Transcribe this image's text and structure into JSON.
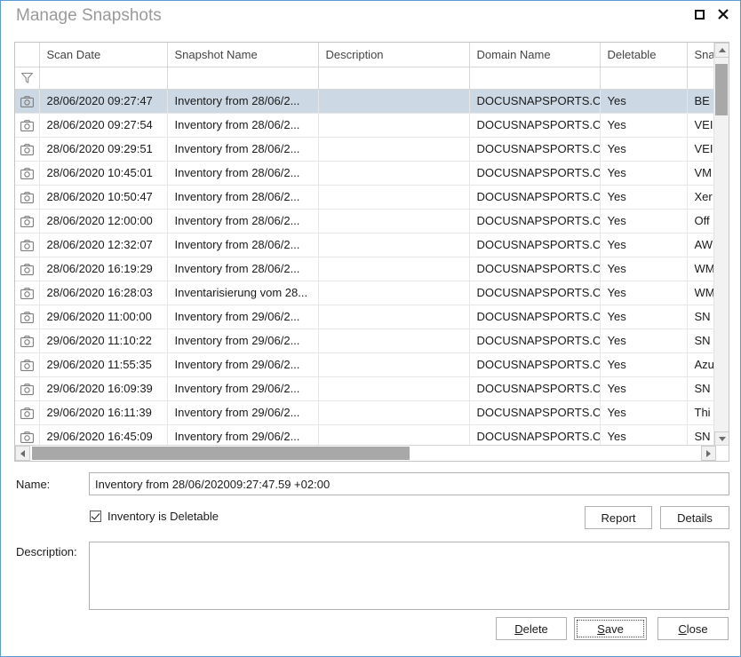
{
  "window": {
    "title": "Manage Snapshots",
    "controls": {
      "maximize": "maximize-icon",
      "close": "close-icon"
    }
  },
  "grid": {
    "columns": [
      {
        "key": "icon",
        "label": ""
      },
      {
        "key": "date",
        "label": "Scan Date"
      },
      {
        "key": "name",
        "label": "Snapshot Name"
      },
      {
        "key": "desc",
        "label": "Description"
      },
      {
        "key": "domain",
        "label": "Domain Name"
      },
      {
        "key": "del",
        "label": "Deletable"
      },
      {
        "key": "snap",
        "label": "Sna"
      }
    ],
    "filter_icon": "funnel-icon",
    "row_icon": "camera-icon",
    "rows": [
      {
        "date": "28/06/2020 09:27:47",
        "name": "Inventory from 28/06/2...",
        "desc": "",
        "domain": "DOCUSNAPSPORTS.C...",
        "del": "Yes",
        "snap": "BE",
        "selected": true
      },
      {
        "date": "28/06/2020 09:27:54",
        "name": "Inventory from 28/06/2...",
        "desc": "",
        "domain": "DOCUSNAPSPORTS.C...",
        "del": "Yes",
        "snap": "VEI",
        "selected": false
      },
      {
        "date": "28/06/2020 09:29:51",
        "name": "Inventory from 28/06/2...",
        "desc": "",
        "domain": "DOCUSNAPSPORTS.C...",
        "del": "Yes",
        "snap": "VEI",
        "selected": false
      },
      {
        "date": "28/06/2020 10:45:01",
        "name": "Inventory from 28/06/2...",
        "desc": "",
        "domain": "DOCUSNAPSPORTS.C...",
        "del": "Yes",
        "snap": "VM",
        "selected": false
      },
      {
        "date": "28/06/2020 10:50:47",
        "name": "Inventory from 28/06/2...",
        "desc": "",
        "domain": "DOCUSNAPSPORTS.C...",
        "del": "Yes",
        "snap": "Xer",
        "selected": false
      },
      {
        "date": "28/06/2020 12:00:00",
        "name": "Inventory from 28/06/2...",
        "desc": "",
        "domain": "DOCUSNAPSPORTS.C...",
        "del": "Yes",
        "snap": "Off",
        "selected": false
      },
      {
        "date": "28/06/2020 12:32:07",
        "name": "Inventory from 28/06/2...",
        "desc": "",
        "domain": "DOCUSNAPSPORTS.C...",
        "del": "Yes",
        "snap": "AW",
        "selected": false
      },
      {
        "date": "28/06/2020 16:19:29",
        "name": "Inventory from 28/06/2...",
        "desc": "",
        "domain": "DOCUSNAPSPORTS.C...",
        "del": "Yes",
        "snap": "WM",
        "selected": false
      },
      {
        "date": "28/06/2020 16:28:03",
        "name": "Inventarisierung vom 28...",
        "desc": "",
        "domain": "DOCUSNAPSPORTS.C...",
        "del": "Yes",
        "snap": "WM",
        "selected": false
      },
      {
        "date": "29/06/2020 11:00:00",
        "name": "Inventory from 29/06/2...",
        "desc": "",
        "domain": "DOCUSNAPSPORTS.C...",
        "del": "Yes",
        "snap": "SN",
        "selected": false
      },
      {
        "date": "29/06/2020 11:10:22",
        "name": "Inventory from 29/06/2...",
        "desc": "",
        "domain": "DOCUSNAPSPORTS.C...",
        "del": "Yes",
        "snap": "SN",
        "selected": false
      },
      {
        "date": "29/06/2020 11:55:35",
        "name": "Inventory from 29/06/2...",
        "desc": "",
        "domain": "DOCUSNAPSPORTS.C...",
        "del": "Yes",
        "snap": "Azu",
        "selected": false
      },
      {
        "date": "29/06/2020 16:09:39",
        "name": "Inventory from 29/06/2...",
        "desc": "",
        "domain": "DOCUSNAPSPORTS.C...",
        "del": "Yes",
        "snap": "SN",
        "selected": false
      },
      {
        "date": "29/06/2020 16:11:39",
        "name": "Inventory from 29/06/2...",
        "desc": "",
        "domain": "DOCUSNAPSPORTS.C...",
        "del": "Yes",
        "snap": "Thi",
        "selected": false
      },
      {
        "date": "29/06/2020 16:45:09",
        "name": "Inventory from 29/06/2...",
        "desc": "",
        "domain": "DOCUSNAPSPORTS.C...",
        "del": "Yes",
        "snap": "SN",
        "selected": false
      }
    ]
  },
  "form": {
    "name_label": "Name:",
    "name_value": "Inventory from 28/06/202009:27:47.59 +02:00",
    "description_label": "Description:",
    "description_value": "",
    "deletable_label": "Inventory is Deletable",
    "deletable_checked": true,
    "report_label": "Report",
    "details_label": "Details"
  },
  "footer": {
    "delete": {
      "pre": "",
      "accel": "D",
      "post": "elete"
    },
    "save": {
      "pre": "",
      "accel": "S",
      "post": "ave"
    },
    "close": {
      "pre": "",
      "accel": "C",
      "post": "lose"
    }
  },
  "colors": {
    "window_border": "#5b9bd5",
    "title_text": "#9a9a9a",
    "selection": "#ccd8e4",
    "scroll_thumb": "#a8a8a8"
  }
}
